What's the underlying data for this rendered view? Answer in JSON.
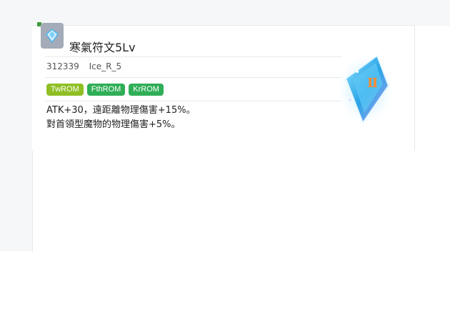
{
  "item": {
    "name": "寒氣符文5Lv",
    "id": "312339",
    "code": "Ice_R_5",
    "tags": [
      {
        "label": "TwROM",
        "color": "#8fbf24"
      },
      {
        "label": "FthROM",
        "color": "#2fae57"
      },
      {
        "label": "KrROM",
        "color": "#2fae57"
      }
    ],
    "description": [
      "ATK+30，遠距離物理傷害+15%。",
      "對首領型魔物的物理傷害+5%。"
    ],
    "icon": "ice-rune-icon",
    "art": "ice-rune-crystal-illustration"
  }
}
